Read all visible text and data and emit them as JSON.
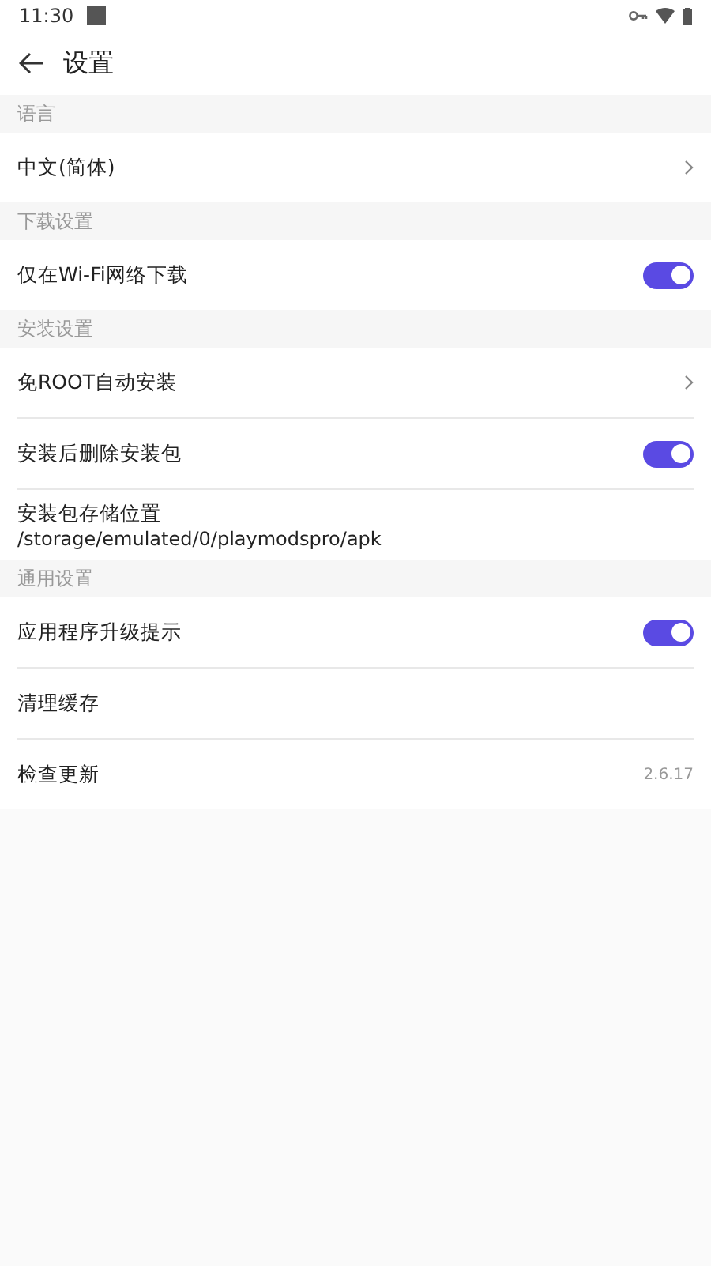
{
  "status_bar": {
    "time": "11:30"
  },
  "header": {
    "title": "设置"
  },
  "sections": [
    {
      "title": "语言",
      "items": [
        {
          "kind": "link",
          "label": "中文(简体)"
        }
      ]
    },
    {
      "title": "下载设置",
      "items": [
        {
          "kind": "toggle",
          "label": "仅在Wi-Fi网络下载",
          "on": true
        }
      ]
    },
    {
      "title": "安装设置",
      "items": [
        {
          "kind": "link",
          "label": "免ROOT自动安装"
        },
        {
          "kind": "toggle",
          "label": "安装后删除安装包",
          "on": true
        },
        {
          "kind": "detail",
          "label": "安装包存储位置",
          "subtitle": "/storage/emulated/0/playmodspro/apk"
        }
      ]
    },
    {
      "title": "通用设置",
      "items": [
        {
          "kind": "toggle",
          "label": "应用程序升级提示",
          "on": true
        },
        {
          "kind": "plain",
          "label": "清理缓存"
        },
        {
          "kind": "value",
          "label": "检查更新",
          "value": "2.6.17"
        }
      ]
    }
  ]
}
